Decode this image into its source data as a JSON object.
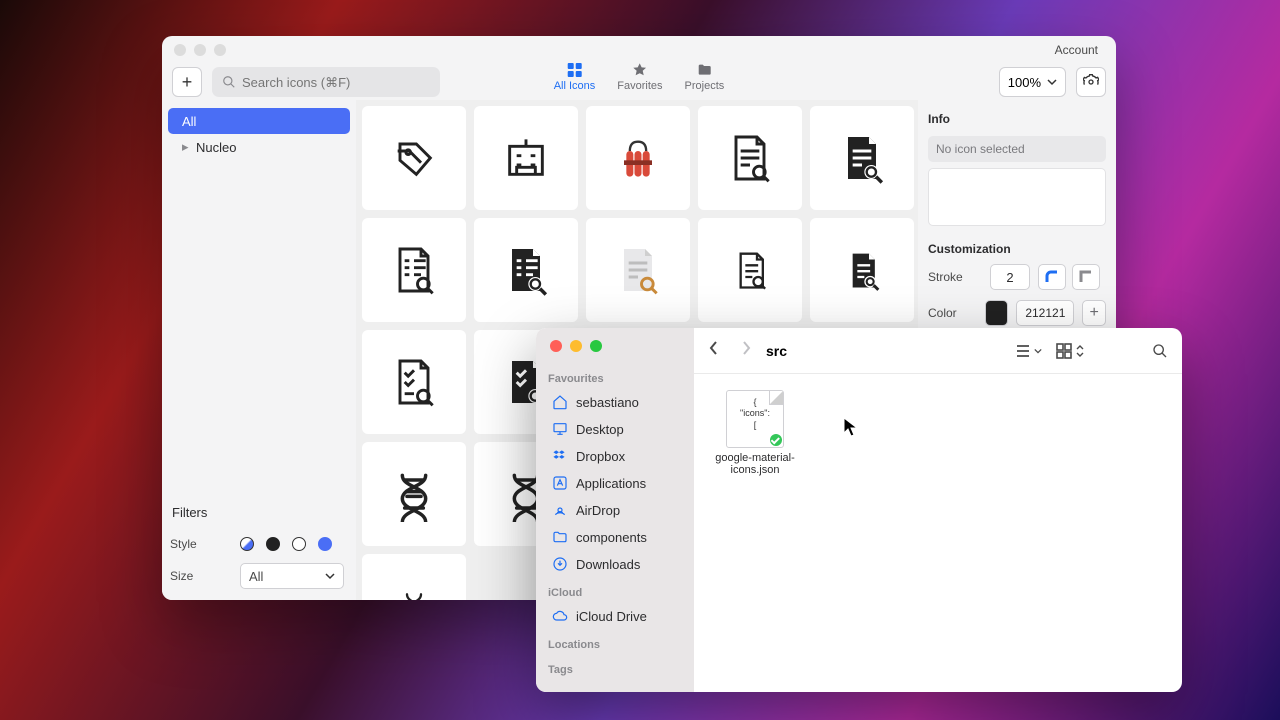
{
  "app": {
    "account_label": "Account",
    "add_label": "+",
    "search": {
      "placeholder": "Search icons (⌘F)"
    },
    "tabs": {
      "all_icons": "All Icons",
      "favorites": "Favorites",
      "projects": "Projects"
    },
    "zoom_label": "100%",
    "sidebar": {
      "all": "All",
      "nucleo": "Nucleo"
    },
    "filters": {
      "title": "Filters",
      "style_label": "Style",
      "size_label": "Size",
      "size_value": "All"
    },
    "inspector": {
      "info_title": "Info",
      "empty_text": "No icon selected",
      "customization_title": "Customization",
      "stroke_label": "Stroke",
      "stroke_value": "2",
      "color_label": "Color",
      "color_value": "212121",
      "color_hex": "#212121"
    }
  },
  "finder": {
    "title": "src",
    "sections": {
      "favourites": "Favourites",
      "icloud": "iCloud",
      "locations": "Locations",
      "tags": "Tags"
    },
    "items": {
      "sebastiano": "sebastiano",
      "desktop": "Desktop",
      "dropbox": "Dropbox",
      "applications": "Applications",
      "airdrop": "AirDrop",
      "components": "components",
      "downloads": "Downloads",
      "iclouddrive": "iCloud Drive"
    },
    "file": {
      "name": "google-material-icons.json",
      "preview_line1": "{",
      "preview_line2": "\"icons\":",
      "preview_line3": "["
    }
  }
}
